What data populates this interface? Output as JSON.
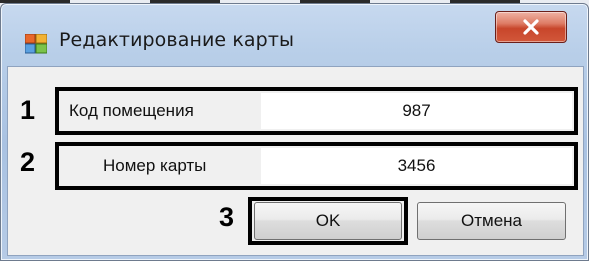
{
  "window": {
    "title": "Редактирование карты",
    "close_icon": "close-x-icon",
    "app_icon": "form-icon"
  },
  "annotations": {
    "marker_1": "1",
    "marker_2": "2",
    "marker_3": "3"
  },
  "fields": [
    {
      "label": "Код помещения",
      "value": "987"
    },
    {
      "label": "Номер карты",
      "value": "3456"
    }
  ],
  "buttons": {
    "ok_label": "OK",
    "cancel_label": "Отмена"
  },
  "colors": {
    "close_button": "#c8462b",
    "annotation_outline": "#000000"
  }
}
